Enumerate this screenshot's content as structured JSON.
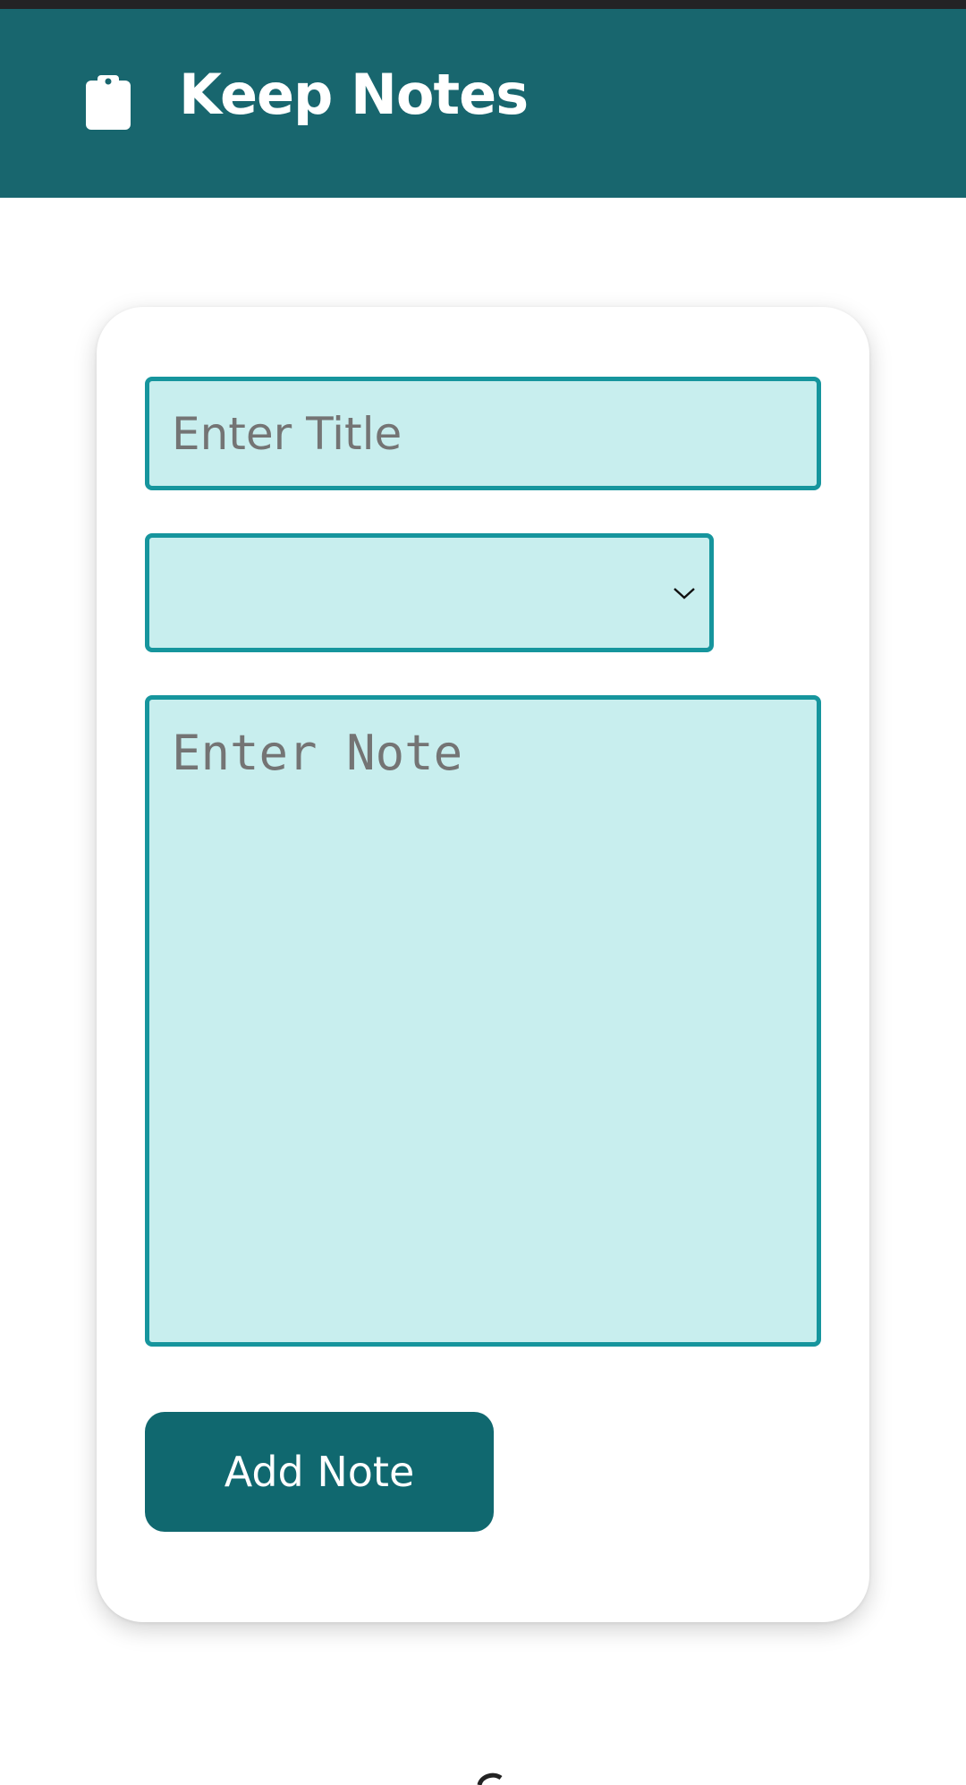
{
  "header": {
    "title": "Keep Notes",
    "icon": "clipboard-icon",
    "background_color": "#18666e"
  },
  "form": {
    "title_placeholder": "Enter Title",
    "title_value": "",
    "category_selected": "",
    "category_icon": "chevron-down-icon",
    "note_placeholder": "Enter Note",
    "note_value": "",
    "submit_label": "Add Note",
    "field_background": "#c8eeee",
    "field_border": "#16959d",
    "button_color": "#10686f"
  }
}
